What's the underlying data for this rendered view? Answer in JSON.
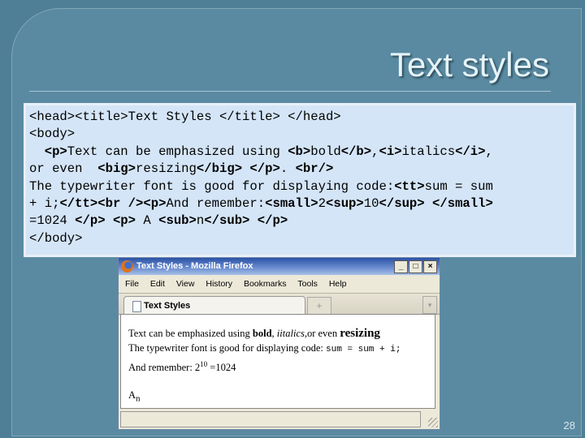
{
  "slide": {
    "title": "Text styles",
    "page_number": "28"
  },
  "code_lines": [
    [
      {
        "t": "<head><title>Text Styles </title> </head>",
        "b": false
      }
    ],
    [
      {
        "t": "<body>",
        "b": false
      }
    ],
    [
      {
        "t": "  ",
        "b": false
      },
      {
        "t": "<p>",
        "b": true
      },
      {
        "t": "Text can be emphasized using ",
        "b": false
      },
      {
        "t": "<b>",
        "b": true
      },
      {
        "t": "bold",
        "b": false
      },
      {
        "t": "</b>",
        "b": true
      },
      {
        "t": ",",
        "b": false
      },
      {
        "t": "<i>",
        "b": true
      },
      {
        "t": "italics",
        "b": false
      },
      {
        "t": "</i>",
        "b": true
      },
      {
        "t": ",",
        "b": false
      }
    ],
    [
      {
        "t": "or even  ",
        "b": false
      },
      {
        "t": "<big>",
        "b": true
      },
      {
        "t": "resizing",
        "b": false
      },
      {
        "t": "</big>",
        "b": true
      },
      {
        "t": " ",
        "b": false
      },
      {
        "t": "</p>",
        "b": true
      },
      {
        "t": ". ",
        "b": false
      },
      {
        "t": "<br/>",
        "b": true
      }
    ],
    [
      {
        "t": "The typewriter font is good for displaying code:",
        "b": false
      },
      {
        "t": "<tt>",
        "b": true
      },
      {
        "t": "sum = sum",
        "b": false
      }
    ],
    [
      {
        "t": "+ i;",
        "b": false
      },
      {
        "t": "</tt><br />",
        "b": true
      },
      {
        "t": "<p>",
        "b": true
      },
      {
        "t": "And remember:",
        "b": false
      },
      {
        "t": "<small>",
        "b": true
      },
      {
        "t": "2",
        "b": false
      },
      {
        "t": "<sup>",
        "b": true
      },
      {
        "t": "10",
        "b": false
      },
      {
        "t": "</sup> </small>",
        "b": true
      }
    ],
    [
      {
        "t": "=1024 ",
        "b": false
      },
      {
        "t": "</p> <p>",
        "b": true
      },
      {
        "t": " A ",
        "b": false
      },
      {
        "t": "<sub>",
        "b": true
      },
      {
        "t": "n",
        "b": false
      },
      {
        "t": "</sub> </p>",
        "b": true
      }
    ],
    [
      {
        "t": "</body>",
        "b": false
      }
    ]
  ],
  "browser": {
    "window_title": "Text Styles - Mozilla Firefox",
    "buttons": {
      "minimize": "_",
      "maximize": "□",
      "close": "×"
    },
    "menu": [
      "File",
      "Edit",
      "View",
      "History",
      "Bookmarks",
      "Tools",
      "Help"
    ],
    "tab_label": "Text Styles",
    "new_tab": "+",
    "tab_list": "▾",
    "content": {
      "line1_pre": "Text can be emphasized using ",
      "bold": "bold",
      "comma": ", ",
      "italics": "iitalics",
      "line1_mid": ",or even ",
      "big": "resizing",
      "line2_pre": "The typewriter font is good for displaying code: ",
      "tt": "sum = sum + i;",
      "line3_pre": "And remember: 2",
      "sup": "10",
      "line3_post": " =1024",
      "line4": "A",
      "sub": "n"
    }
  }
}
